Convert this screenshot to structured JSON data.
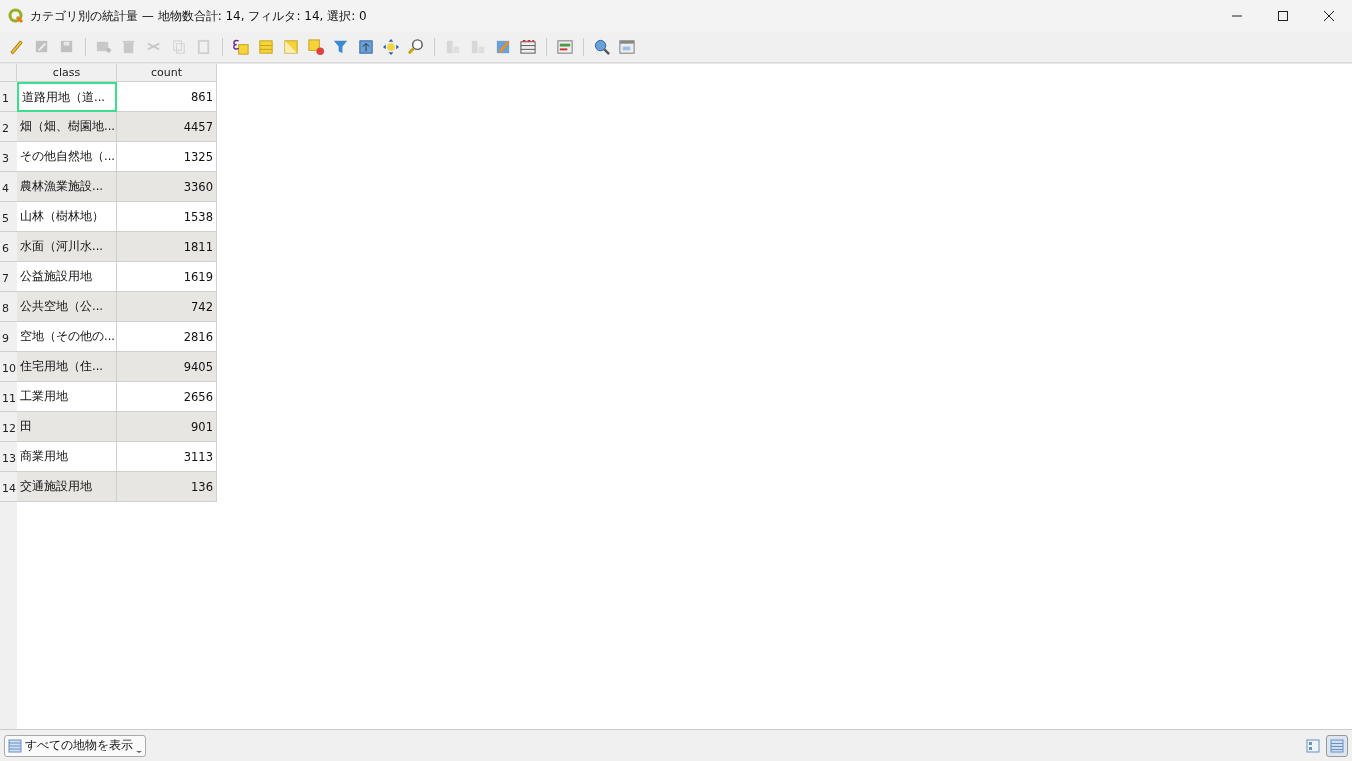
{
  "window": {
    "title": "カテゴリ別の統計量 — 地物数合計: 14, フィルタ: 14, 選択: 0"
  },
  "toolbar": [
    {
      "kind": "pencil",
      "disabled": false
    },
    {
      "kind": "multi-edit",
      "disabled": true
    },
    {
      "kind": "save",
      "disabled": true
    },
    {
      "kind": "sep"
    },
    {
      "kind": "add-row",
      "disabled": true
    },
    {
      "kind": "trash",
      "disabled": true
    },
    {
      "kind": "scissors",
      "disabled": true
    },
    {
      "kind": "copy",
      "disabled": true
    },
    {
      "kind": "paste",
      "disabled": true
    },
    {
      "kind": "sep"
    },
    {
      "kind": "expression-select",
      "disabled": false
    },
    {
      "kind": "select-all",
      "disabled": false
    },
    {
      "kind": "invert",
      "disabled": false
    },
    {
      "kind": "deselect",
      "disabled": false
    },
    {
      "kind": "filter",
      "disabled": false
    },
    {
      "kind": "move-top",
      "disabled": false
    },
    {
      "kind": "pan",
      "disabled": false
    },
    {
      "kind": "zoom",
      "disabled": false
    },
    {
      "kind": "sep"
    },
    {
      "kind": "column-new",
      "disabled": true
    },
    {
      "kind": "column-delete",
      "disabled": true
    },
    {
      "kind": "field-calc",
      "disabled": false
    },
    {
      "kind": "conditional",
      "disabled": false
    },
    {
      "kind": "sep"
    },
    {
      "kind": "dock",
      "disabled": false
    },
    {
      "kind": "sep"
    },
    {
      "kind": "actions",
      "disabled": false
    },
    {
      "kind": "form",
      "disabled": false
    }
  ],
  "table": {
    "columns": [
      "class",
      "count"
    ],
    "rows": [
      {
        "number": "1",
        "class": "道路用地（道...",
        "count": "861",
        "focused": true
      },
      {
        "number": "2",
        "class": "畑（畑、樹園地...",
        "count": "4457",
        "focused": false
      },
      {
        "number": "3",
        "class": "その他自然地（...",
        "count": "1325",
        "focused": false
      },
      {
        "number": "4",
        "class": "農林漁業施設...",
        "count": "3360",
        "focused": false
      },
      {
        "number": "5",
        "class": "山林（樹林地）",
        "count": "1538",
        "focused": false
      },
      {
        "number": "6",
        "class": "水面（河川水...",
        "count": "1811",
        "focused": false
      },
      {
        "number": "7",
        "class": "公益施設用地",
        "count": "1619",
        "focused": false
      },
      {
        "number": "8",
        "class": "公共空地（公...",
        "count": "742",
        "focused": false
      },
      {
        "number": "9",
        "class": "空地（その他の...",
        "count": "2816",
        "focused": false
      },
      {
        "number": "10",
        "class": "住宅用地（住...",
        "count": "9405",
        "focused": false
      },
      {
        "number": "11",
        "class": "工業用地",
        "count": "2656",
        "focused": false
      },
      {
        "number": "12",
        "class": "田",
        "count": "901",
        "focused": false
      },
      {
        "number": "13",
        "class": "商業用地",
        "count": "3113",
        "focused": false
      },
      {
        "number": "14",
        "class": "交通施設用地",
        "count": "136",
        "focused": false
      }
    ]
  },
  "status_bar": {
    "filter_button": "すべての地物を表示",
    "view_buttons": [
      {
        "kind": "form",
        "selected": false
      },
      {
        "kind": "table",
        "selected": true
      }
    ]
  }
}
